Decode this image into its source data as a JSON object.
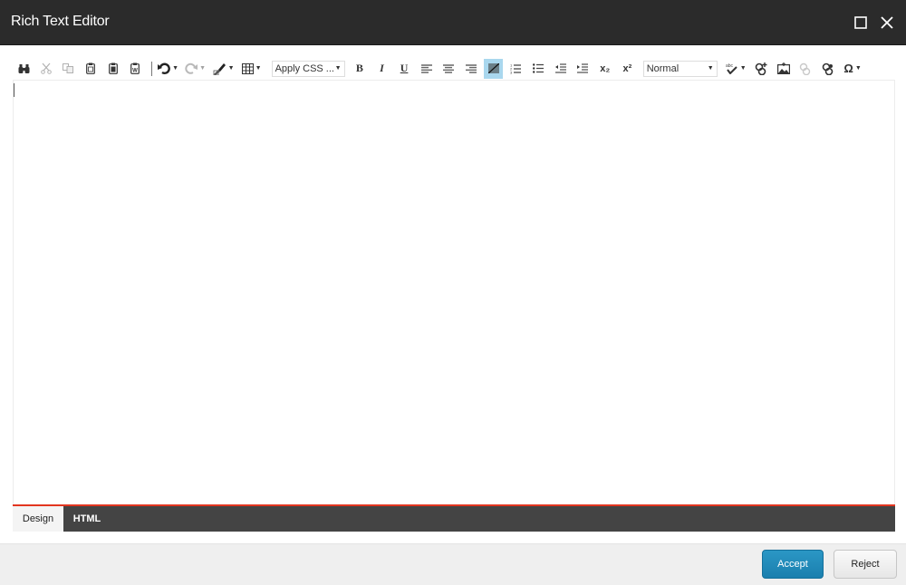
{
  "window": {
    "title": "Rich Text Editor",
    "maximize_icon": "maximize-icon",
    "close_icon": "close-icon"
  },
  "toolbar": {
    "buttons": [
      {
        "name": "find",
        "icon": "binoculars-icon",
        "enabled": true
      },
      {
        "name": "cut",
        "icon": "scissors-icon",
        "enabled": false
      },
      {
        "name": "copy",
        "icon": "copy-icon",
        "enabled": false
      },
      {
        "name": "paste",
        "icon": "clipboard-icon",
        "enabled": true
      },
      {
        "name": "paste-plain-text",
        "icon": "clipboard-text-icon",
        "enabled": true
      },
      {
        "name": "paste-from-word",
        "icon": "clipboard-word-icon",
        "enabled": true
      },
      {
        "name": "undo",
        "icon": "undo-icon",
        "enabled": true,
        "dropdown": true
      },
      {
        "name": "redo",
        "icon": "redo-icon",
        "enabled": false,
        "dropdown": true
      },
      {
        "name": "format-stripper",
        "icon": "brush-icon",
        "enabled": true,
        "dropdown": true
      },
      {
        "name": "insert-table",
        "icon": "table-icon",
        "enabled": true,
        "dropdown": true
      },
      {
        "name": "bold",
        "icon": "bold-icon",
        "label": "B"
      },
      {
        "name": "italic",
        "icon": "italic-icon",
        "label": "I"
      },
      {
        "name": "underline",
        "icon": "underline-icon",
        "label": "U"
      },
      {
        "name": "align-left",
        "icon": "align-left-icon"
      },
      {
        "name": "align-center",
        "icon": "align-center-icon"
      },
      {
        "name": "align-right",
        "icon": "align-right-icon"
      },
      {
        "name": "align-none",
        "icon": "align-none-icon",
        "active": true
      },
      {
        "name": "numbered-list",
        "icon": "ordered-list-icon"
      },
      {
        "name": "bulleted-list",
        "icon": "unordered-list-icon"
      },
      {
        "name": "outdent",
        "icon": "outdent-icon"
      },
      {
        "name": "indent",
        "icon": "indent-icon"
      },
      {
        "name": "subscript",
        "icon": "subscript-icon",
        "label": "x₂"
      },
      {
        "name": "superscript",
        "icon": "superscript-icon",
        "label": "x²"
      },
      {
        "name": "spellcheck",
        "icon": "spellcheck-icon",
        "dropdown": true
      },
      {
        "name": "insert-link",
        "icon": "link-add-icon"
      },
      {
        "name": "insert-image",
        "icon": "image-icon"
      },
      {
        "name": "remove-link",
        "icon": "link-remove-icon",
        "enabled": false
      },
      {
        "name": "link-manager",
        "icon": "link-icon"
      },
      {
        "name": "insert-symbol",
        "icon": "omega-icon",
        "label": "Ω",
        "dropdown": true
      }
    ],
    "css_class_select": {
      "value": "Apply CSS ..."
    },
    "paragraph_style_select": {
      "value": "Normal"
    }
  },
  "editor": {
    "content": ""
  },
  "modes": {
    "design": "Design",
    "html": "HTML",
    "active": "Design"
  },
  "footer": {
    "accept": "Accept",
    "reject": "Reject"
  },
  "colors": {
    "titlebar": "#2b2b2b",
    "accent_line": "#e2351f",
    "accept_button": "#1f8bbb",
    "active_tool": "#a9d7ee",
    "modebar": "#444444"
  }
}
